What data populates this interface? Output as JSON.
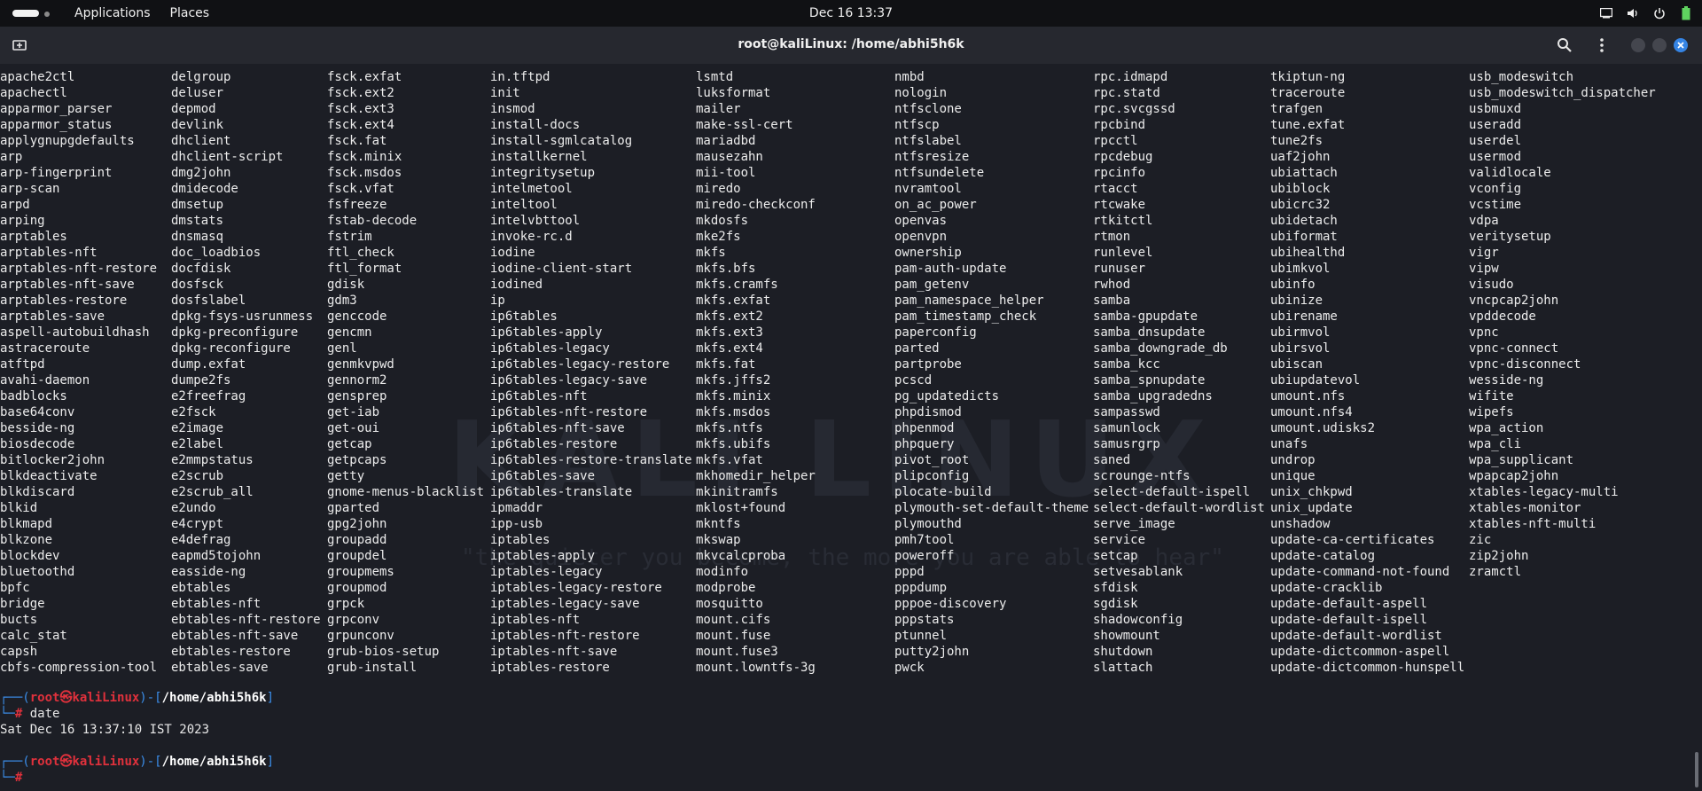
{
  "topbar": {
    "menu": [
      "Applications",
      "Places"
    ],
    "clock": "Dec 16  13:37"
  },
  "header": {
    "title": "root@kaliLinux: /home/abhi5h6k"
  },
  "watermark": {
    "logo": "KALI LINUX",
    "quote": "\"the quieter you become, the more you are able to hear\""
  },
  "listing": {
    "columns": [
      [
        "apache2ctl",
        "apachectl",
        "apparmor_parser",
        "apparmor_status",
        "applygnupgdefaults",
        "arp",
        "arp-fingerprint",
        "arp-scan",
        "arpd",
        "arping",
        "arptables",
        "arptables-nft",
        "arptables-nft-restore",
        "arptables-nft-save",
        "arptables-restore",
        "arptables-save",
        "aspell-autobuildhash",
        "astraceroute",
        "atftpd",
        "avahi-daemon",
        "badblocks",
        "base64conv",
        "besside-ng",
        "biosdecode",
        "bitlocker2john",
        "blkdeactivate",
        "blkdiscard",
        "blkid",
        "blkmapd",
        "blkzone",
        "blockdev",
        "bluetoothd",
        "bpfc",
        "bridge",
        "bucts",
        "calc_stat",
        "capsh",
        "cbfs-compression-tool"
      ],
      [
        "delgroup",
        "deluser",
        "depmod",
        "devlink",
        "dhclient",
        "dhclient-script",
        "dmg2john",
        "dmidecode",
        "dmsetup",
        "dmstats",
        "dnsmasq",
        "doc_loadbios",
        "docfdisk",
        "dosfsck",
        "dosfslabel",
        "dpkg-fsys-usrunmess",
        "dpkg-preconfigure",
        "dpkg-reconfigure",
        "dump.exfat",
        "dumpe2fs",
        "e2freefrag",
        "e2fsck",
        "e2image",
        "e2label",
        "e2mmpstatus",
        "e2scrub",
        "e2scrub_all",
        "e2undo",
        "e4crypt",
        "e4defrag",
        "eapmd5tojohn",
        "easside-ng",
        "ebtables",
        "ebtables-nft",
        "ebtables-nft-restore",
        "ebtables-nft-save",
        "ebtables-restore",
        "ebtables-save"
      ],
      [
        "fsck.exfat",
        "fsck.ext2",
        "fsck.ext3",
        "fsck.ext4",
        "fsck.fat",
        "fsck.minix",
        "fsck.msdos",
        "fsck.vfat",
        "fsfreeze",
        "fstab-decode",
        "fstrim",
        "ftl_check",
        "ftl_format",
        "gdisk",
        "gdm3",
        "genccode",
        "gencmn",
        "genl",
        "genmkvpwd",
        "gennorm2",
        "gensprep",
        "get-iab",
        "get-oui",
        "getcap",
        "getpcaps",
        "getty",
        "gnome-menus-blacklist",
        "gparted",
        "gpg2john",
        "groupadd",
        "groupdel",
        "groupmems",
        "groupmod",
        "grpck",
        "grpconv",
        "grpunconv",
        "grub-bios-setup",
        "grub-install"
      ],
      [
        "in.tftpd",
        "init",
        "insmod",
        "install-docs",
        "install-sgmlcatalog",
        "installkernel",
        "integritysetup",
        "intelmetool",
        "inteltool",
        "intelvbttool",
        "invoke-rc.d",
        "iodine",
        "iodine-client-start",
        "iodined",
        "ip",
        "ip6tables",
        "ip6tables-apply",
        "ip6tables-legacy",
        "ip6tables-legacy-restore",
        "ip6tables-legacy-save",
        "ip6tables-nft",
        "ip6tables-nft-restore",
        "ip6tables-nft-save",
        "ip6tables-restore",
        "ip6tables-restore-translate",
        "ip6tables-save",
        "ip6tables-translate",
        "ipmaddr",
        "ipp-usb",
        "iptables",
        "iptables-apply",
        "iptables-legacy",
        "iptables-legacy-restore",
        "iptables-legacy-save",
        "iptables-nft",
        "iptables-nft-restore",
        "iptables-nft-save",
        "iptables-restore"
      ],
      [
        "lsmtd",
        "luksformat",
        "mailer",
        "make-ssl-cert",
        "mariadbd",
        "mausezahn",
        "mii-tool",
        "miredo",
        "miredo-checkconf",
        "mkdosfs",
        "mke2fs",
        "mkfs",
        "mkfs.bfs",
        "mkfs.cramfs",
        "mkfs.exfat",
        "mkfs.ext2",
        "mkfs.ext3",
        "mkfs.ext4",
        "mkfs.fat",
        "mkfs.jffs2",
        "mkfs.minix",
        "mkfs.msdos",
        "mkfs.ntfs",
        "mkfs.ubifs",
        "mkfs.vfat",
        "mkhomedir_helper",
        "mkinitramfs",
        "mklost+found",
        "mkntfs",
        "mkswap",
        "mkvcalcproba",
        "modinfo",
        "modprobe",
        "mosquitto",
        "mount.cifs",
        "mount.fuse",
        "mount.fuse3",
        "mount.lowntfs-3g"
      ],
      [
        "nmbd",
        "nologin",
        "ntfsclone",
        "ntfscp",
        "ntfslabel",
        "ntfsresize",
        "ntfsundelete",
        "nvramtool",
        "on_ac_power",
        "openvas",
        "openvpn",
        "ownership",
        "pam-auth-update",
        "pam_getenv",
        "pam_namespace_helper",
        "pam_timestamp_check",
        "paperconfig",
        "parted",
        "partprobe",
        "pcscd",
        "pg_updatedicts",
        "phpdismod",
        "phpenmod",
        "phpquery",
        "pivot_root",
        "plipconfig",
        "plocate-build",
        "plymouth-set-default-theme",
        "plymouthd",
        "pmh7tool",
        "poweroff",
        "pppd",
        "pppdump",
        "pppoe-discovery",
        "ppp­stats",
        "ptunnel",
        "putty2john",
        "pwck"
      ],
      [
        "rpc.idmapd",
        "rpc.statd",
        "rpc.svcgssd",
        "rpcbind",
        "rpcctl",
        "rpcdebug",
        "rpcinfo",
        "rtacct",
        "rtcwake",
        "rtkitctl",
        "rtmon",
        "runlevel",
        "runuser",
        "rwhod",
        "samba",
        "samba-gpupdate",
        "samba_dnsupdate",
        "samba_downgrade_db",
        "samba_kcc",
        "samba_spnupdate",
        "samba_upgradedns",
        "sampasswd",
        "samunlock",
        "samusrgrp",
        "saned",
        "scrounge-ntfs",
        "select-default-ispell",
        "select-default-wordlist",
        "serve_image",
        "service",
        "setcap",
        "setvesablank",
        "sfdisk",
        "sgdisk",
        "shadowconfig",
        "showmount",
        "shutdown",
        "slattach"
      ],
      [
        "tkiptun-ng",
        "traceroute",
        "trafgen",
        "tune.exfat",
        "tune2fs",
        "uaf2john",
        "ubiattach",
        "ubiblock",
        "ubicrc32",
        "ubidetach",
        "ubiformat",
        "ubihealthd",
        "ubimkvol",
        "ubinfo",
        "ubinize",
        "ubirename",
        "ubirmvol",
        "ubirsvol",
        "ubiscan",
        "ubiupdatevol",
        "umount.nfs",
        "umount.nfs4",
        "umount.udisks2",
        "unafs",
        "undrop",
        "unique",
        "unix_chkpwd",
        "unix_update",
        "unshadow",
        "update-ca-certificates",
        "update-catalog",
        "update-command-not-found",
        "update-cracklib",
        "update-default-aspell",
        "update-default-ispell",
        "update-default-wordlist",
        "update-dictcommon-aspell",
        "update-dictcommon-hunspell"
      ],
      [
        "usb_modeswitch",
        "usb_modeswitch_dispatcher",
        "usbmuxd",
        "useradd",
        "userdel",
        "usermod",
        "validlocale",
        "vconfig",
        "vcstime",
        "vdpa",
        "veritysetup",
        "vigr",
        "vipw",
        "visudo",
        "vncpcap2john",
        "vpddecode",
        "vpnc",
        "vpnc-connect",
        "vpnc-disconnect",
        "wesside-ng",
        "wifite",
        "wipefs",
        "wpa_action",
        "wpa_cli",
        "wpa_supplicant",
        "wpapcap2john",
        "xtables-legacy-multi",
        "xtables-monitor",
        "xtables-nft-multi",
        "zic",
        "zip2john",
        "zramctl"
      ]
    ]
  },
  "prompt1": {
    "open": "┌──(",
    "user": "root",
    "at": "㉿",
    "host": "kaliLinux",
    "mid": ")-[",
    "path": "/home/abhi5h6k",
    "close": "]",
    "lead": "└─",
    "hash": "#",
    "command": " date"
  },
  "output": "Sat Dec 16 13:37:10 IST 2023",
  "prompt2": {
    "open": "┌──(",
    "user": "root",
    "at": "㉿",
    "host": "kaliLinux",
    "mid": ")-[",
    "path": "/home/abhi5h6k",
    "close": "]",
    "lead": "└─",
    "hash": "#"
  },
  "colors": {
    "accent_blue": "#3b8eea",
    "prompt_red": "#e0313c",
    "close_button": "#3584e4"
  },
  "icons": [
    "activities-icon",
    "new-tab-icon",
    "search-icon",
    "menu-icon",
    "minimize-icon",
    "maximize-icon",
    "close-icon",
    "display-icon",
    "volume-icon",
    "battery-icon"
  ]
}
